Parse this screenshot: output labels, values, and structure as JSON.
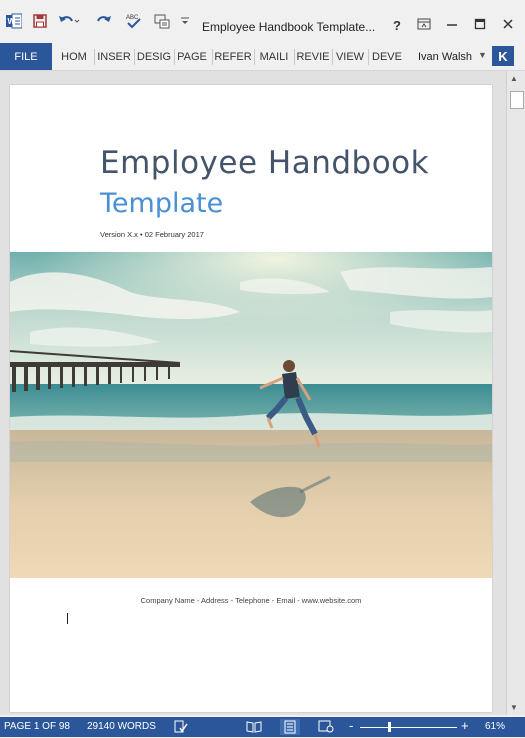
{
  "app": {
    "doc_title": "Employee Handbook Template...",
    "help": "?",
    "user_name": "Ivan Walsh",
    "user_initial": "K"
  },
  "quick_access": [
    "word-icon",
    "save-icon",
    "undo-icon",
    "redo-icon",
    "spelling-icon",
    "touch-mode-icon",
    "customize-icon"
  ],
  "ribbon": {
    "tabs": [
      "FILE",
      "HOM",
      "INSER",
      "DESIG",
      "PAGE",
      "REFER",
      "MAILI",
      "REVIE",
      "VIEW",
      "DEVE"
    ]
  },
  "document": {
    "title": "Employee Handbook",
    "subtitle": "Template",
    "version_line": "Version X.x • 02 February 2017",
    "footer_line": "Company Name - Address - Telephone - Email - www.website.com"
  },
  "status": {
    "page": "PAGE 1 OF 98",
    "words": "29140 WORDS",
    "zoom": "61%",
    "zoom_minus": "-",
    "zoom_plus": "+"
  },
  "colors": {
    "accent": "#2b579a",
    "title": "#44546a",
    "subtitle": "#4a8fd4"
  }
}
